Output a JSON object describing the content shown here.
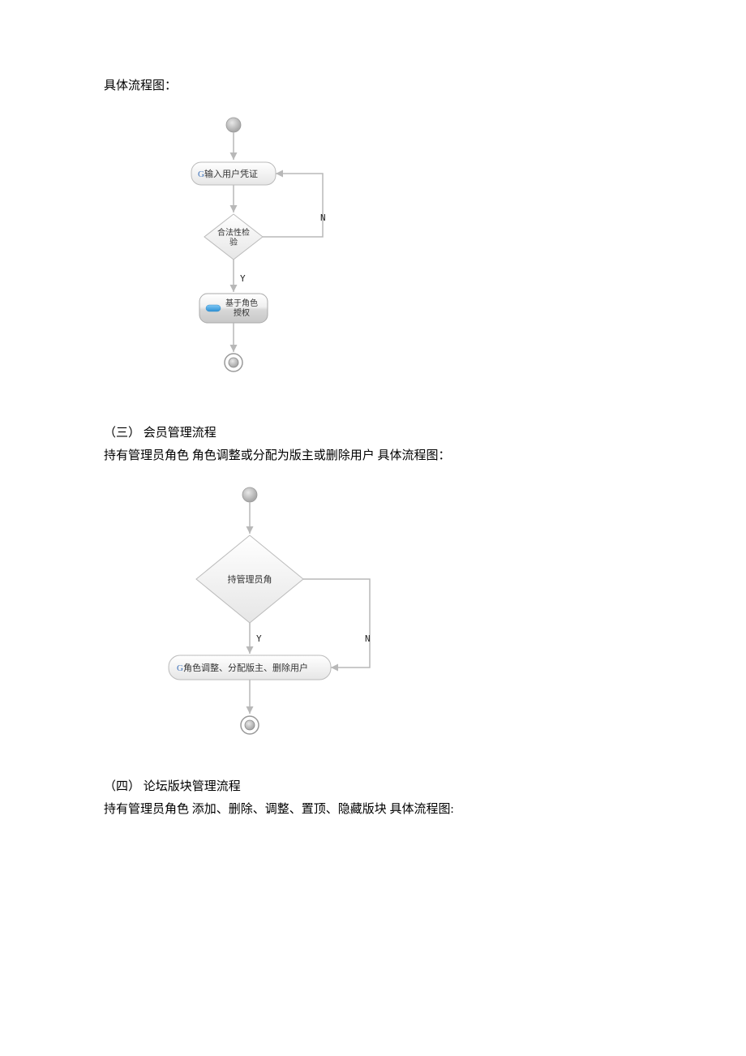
{
  "text": {
    "intro1": "具体流程图：",
    "section3_title": "（三）  会员管理流程",
    "section3_desc": "持有管理员角色 角色调整或分配为版主或删除用户 具体流程图：",
    "section4_title": "（四）  论坛版块管理流程",
    "section4_desc": "持有管理员角色 添加、删除、调整、置顶、隐藏版块 具体流程图:"
  },
  "flowchart1": {
    "node_input_prefix": "G",
    "node_input": "输入用户凭证",
    "node_decision_line1": "合法性检",
    "node_decision_line2": "验",
    "node_process_line1": "基于角色",
    "node_process_line2": "授权",
    "label_yes": "Y",
    "label_no": "N"
  },
  "flowchart2": {
    "node_decision": "持管理员角",
    "node_process_prefix": "G",
    "node_process": "角色调整、分配版主、删除用户",
    "label_yes": "Y",
    "label_no": "N"
  }
}
